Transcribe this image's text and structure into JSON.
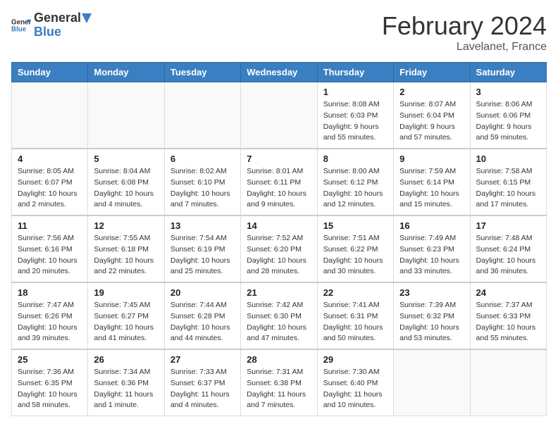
{
  "header": {
    "logo_line1": "General",
    "logo_line2": "Blue",
    "month_title": "February 2024",
    "location": "Lavelanet, France"
  },
  "weekdays": [
    "Sunday",
    "Monday",
    "Tuesday",
    "Wednesday",
    "Thursday",
    "Friday",
    "Saturday"
  ],
  "weeks": [
    [
      {
        "day": "",
        "info": ""
      },
      {
        "day": "",
        "info": ""
      },
      {
        "day": "",
        "info": ""
      },
      {
        "day": "",
        "info": ""
      },
      {
        "day": "1",
        "info": "Sunrise: 8:08 AM\nSunset: 6:03 PM\nDaylight: 9 hours\nand 55 minutes."
      },
      {
        "day": "2",
        "info": "Sunrise: 8:07 AM\nSunset: 6:04 PM\nDaylight: 9 hours\nand 57 minutes."
      },
      {
        "day": "3",
        "info": "Sunrise: 8:06 AM\nSunset: 6:06 PM\nDaylight: 9 hours\nand 59 minutes."
      }
    ],
    [
      {
        "day": "4",
        "info": "Sunrise: 8:05 AM\nSunset: 6:07 PM\nDaylight: 10 hours\nand 2 minutes."
      },
      {
        "day": "5",
        "info": "Sunrise: 8:04 AM\nSunset: 6:08 PM\nDaylight: 10 hours\nand 4 minutes."
      },
      {
        "day": "6",
        "info": "Sunrise: 8:02 AM\nSunset: 6:10 PM\nDaylight: 10 hours\nand 7 minutes."
      },
      {
        "day": "7",
        "info": "Sunrise: 8:01 AM\nSunset: 6:11 PM\nDaylight: 10 hours\nand 9 minutes."
      },
      {
        "day": "8",
        "info": "Sunrise: 8:00 AM\nSunset: 6:12 PM\nDaylight: 10 hours\nand 12 minutes."
      },
      {
        "day": "9",
        "info": "Sunrise: 7:59 AM\nSunset: 6:14 PM\nDaylight: 10 hours\nand 15 minutes."
      },
      {
        "day": "10",
        "info": "Sunrise: 7:58 AM\nSunset: 6:15 PM\nDaylight: 10 hours\nand 17 minutes."
      }
    ],
    [
      {
        "day": "11",
        "info": "Sunrise: 7:56 AM\nSunset: 6:16 PM\nDaylight: 10 hours\nand 20 minutes."
      },
      {
        "day": "12",
        "info": "Sunrise: 7:55 AM\nSunset: 6:18 PM\nDaylight: 10 hours\nand 22 minutes."
      },
      {
        "day": "13",
        "info": "Sunrise: 7:54 AM\nSunset: 6:19 PM\nDaylight: 10 hours\nand 25 minutes."
      },
      {
        "day": "14",
        "info": "Sunrise: 7:52 AM\nSunset: 6:20 PM\nDaylight: 10 hours\nand 28 minutes."
      },
      {
        "day": "15",
        "info": "Sunrise: 7:51 AM\nSunset: 6:22 PM\nDaylight: 10 hours\nand 30 minutes."
      },
      {
        "day": "16",
        "info": "Sunrise: 7:49 AM\nSunset: 6:23 PM\nDaylight: 10 hours\nand 33 minutes."
      },
      {
        "day": "17",
        "info": "Sunrise: 7:48 AM\nSunset: 6:24 PM\nDaylight: 10 hours\nand 36 minutes."
      }
    ],
    [
      {
        "day": "18",
        "info": "Sunrise: 7:47 AM\nSunset: 6:26 PM\nDaylight: 10 hours\nand 39 minutes."
      },
      {
        "day": "19",
        "info": "Sunrise: 7:45 AM\nSunset: 6:27 PM\nDaylight: 10 hours\nand 41 minutes."
      },
      {
        "day": "20",
        "info": "Sunrise: 7:44 AM\nSunset: 6:28 PM\nDaylight: 10 hours\nand 44 minutes."
      },
      {
        "day": "21",
        "info": "Sunrise: 7:42 AM\nSunset: 6:30 PM\nDaylight: 10 hours\nand 47 minutes."
      },
      {
        "day": "22",
        "info": "Sunrise: 7:41 AM\nSunset: 6:31 PM\nDaylight: 10 hours\nand 50 minutes."
      },
      {
        "day": "23",
        "info": "Sunrise: 7:39 AM\nSunset: 6:32 PM\nDaylight: 10 hours\nand 53 minutes."
      },
      {
        "day": "24",
        "info": "Sunrise: 7:37 AM\nSunset: 6:33 PM\nDaylight: 10 hours\nand 55 minutes."
      }
    ],
    [
      {
        "day": "25",
        "info": "Sunrise: 7:36 AM\nSunset: 6:35 PM\nDaylight: 10 hours\nand 58 minutes."
      },
      {
        "day": "26",
        "info": "Sunrise: 7:34 AM\nSunset: 6:36 PM\nDaylight: 11 hours\nand 1 minute."
      },
      {
        "day": "27",
        "info": "Sunrise: 7:33 AM\nSunset: 6:37 PM\nDaylight: 11 hours\nand 4 minutes."
      },
      {
        "day": "28",
        "info": "Sunrise: 7:31 AM\nSunset: 6:38 PM\nDaylight: 11 hours\nand 7 minutes."
      },
      {
        "day": "29",
        "info": "Sunrise: 7:30 AM\nSunset: 6:40 PM\nDaylight: 11 hours\nand 10 minutes."
      },
      {
        "day": "",
        "info": ""
      },
      {
        "day": "",
        "info": ""
      }
    ]
  ]
}
